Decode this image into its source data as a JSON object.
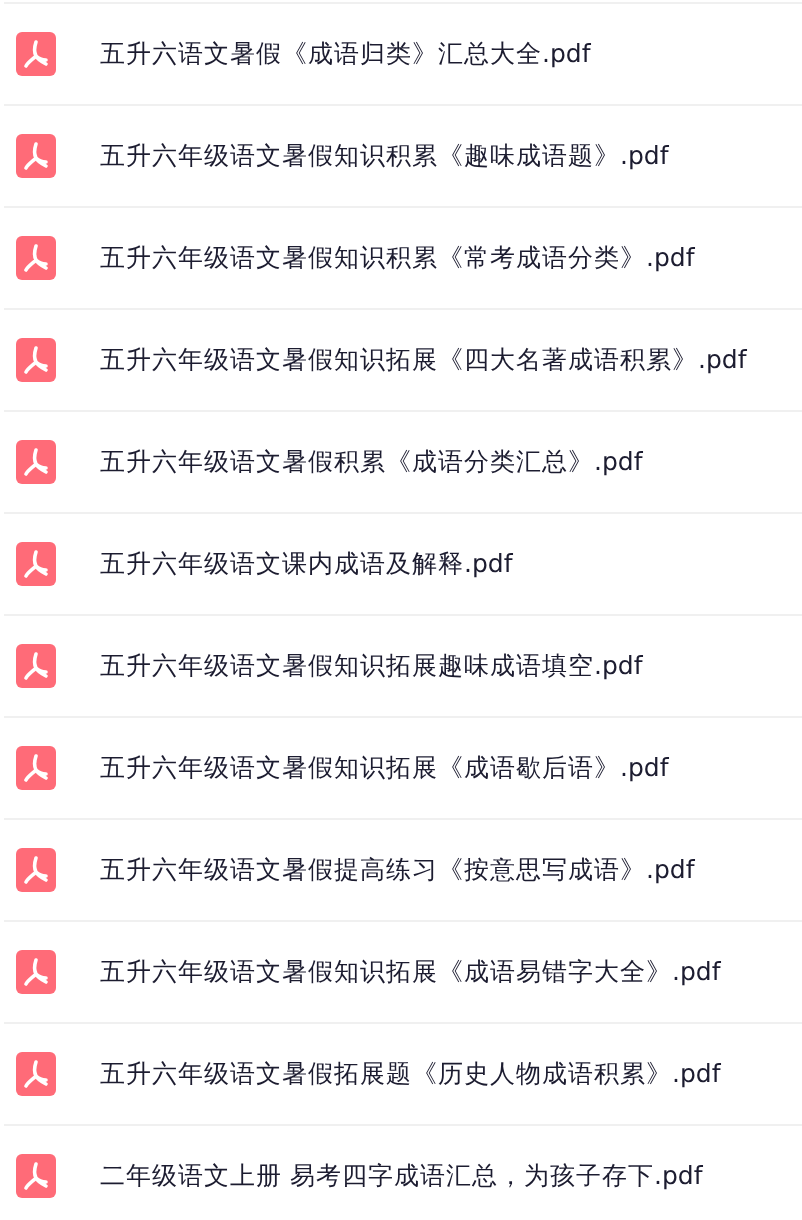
{
  "files": [
    {
      "name": "五升六语文暑假《成语归类》汇总大全.pdf",
      "kind": "pdf"
    },
    {
      "name": "五升六年级语文暑假知识积累《趣味成语题》.pdf",
      "kind": "pdf"
    },
    {
      "name": "五升六年级语文暑假知识积累《常考成语分类》.pdf",
      "kind": "pdf"
    },
    {
      "name": "五升六年级语文暑假知识拓展《四大名著成语积累》.pdf",
      "kind": "pdf"
    },
    {
      "name": "五升六年级语文暑假积累《成语分类汇总》.pdf",
      "kind": "pdf"
    },
    {
      "name": "五升六年级语文课内成语及解释.pdf",
      "kind": "pdf"
    },
    {
      "name": "五升六年级语文暑假知识拓展趣味成语填空.pdf",
      "kind": "pdf"
    },
    {
      "name": "五升六年级语文暑假知识拓展《成语歇后语》.pdf",
      "kind": "pdf"
    },
    {
      "name": "五升六年级语文暑假提高练习《按意思写成语》.pdf",
      "kind": "pdf"
    },
    {
      "name": "五升六年级语文暑假知识拓展《成语易错字大全》.pdf",
      "kind": "pdf"
    },
    {
      "name": "五升六年级语文暑假拓展题《历史人物成语积累》.pdf",
      "kind": "pdf"
    },
    {
      "name": "二年级语文上册 易考四字成语汇总，为孩子存下.pdf",
      "kind": "pdf"
    }
  ]
}
